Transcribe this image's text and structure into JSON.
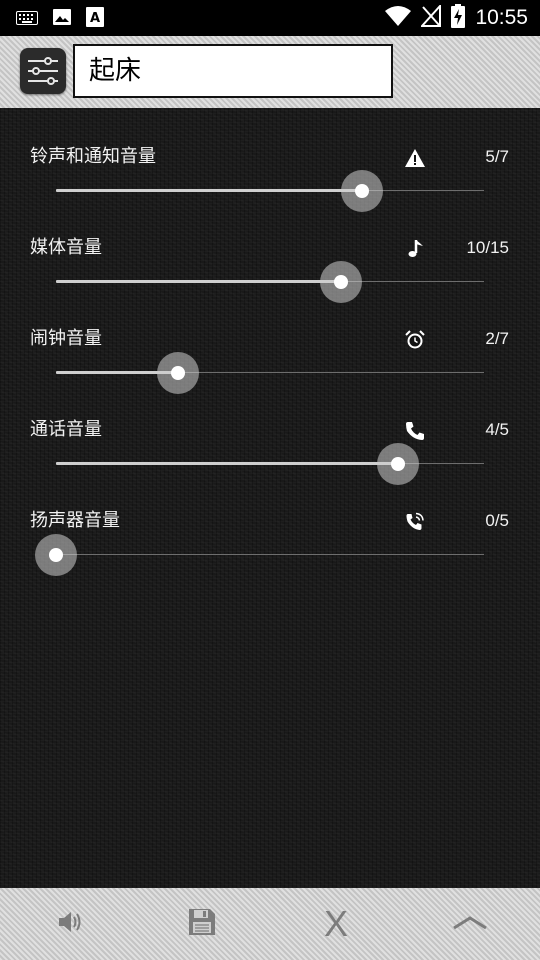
{
  "status_bar": {
    "time": "10:55",
    "left_icons": [
      "keyboard-icon",
      "image-icon",
      "font-icon"
    ],
    "right_icons": [
      "wifi-icon",
      "no-signal-icon",
      "battery-charging-icon"
    ]
  },
  "header": {
    "profile_name": "起床",
    "logo_icon": "equalizer-sliders-icon"
  },
  "volumes": [
    {
      "label": "铃声和通知音量",
      "value_text": "5/7",
      "level": 5,
      "max": 7,
      "icon": "warning-icon"
    },
    {
      "label": "媒体音量",
      "value_text": "10/15",
      "level": 10,
      "max": 15,
      "icon": "music-note-icon"
    },
    {
      "label": "闹钟音量",
      "value_text": "2/7",
      "level": 2,
      "max": 7,
      "icon": "alarm-clock-icon"
    },
    {
      "label": "通话音量",
      "value_text": "4/5",
      "level": 4,
      "max": 5,
      "icon": "phone-icon"
    },
    {
      "label": "扬声器音量",
      "value_text": "0/5",
      "level": 0,
      "max": 5,
      "icon": "speakerphone-icon"
    }
  ],
  "bottom_bar": {
    "buttons": [
      "volume-icon",
      "save-icon",
      "close-x-icon",
      "collapse-up-icon"
    ],
    "close_label": "X"
  },
  "colors": {
    "background": "#191919",
    "header_bg": "#cfcfcf",
    "text": "#f2f2f2",
    "slider_fill": "#cfcfcf",
    "slider_track": "#6d6d6d"
  }
}
